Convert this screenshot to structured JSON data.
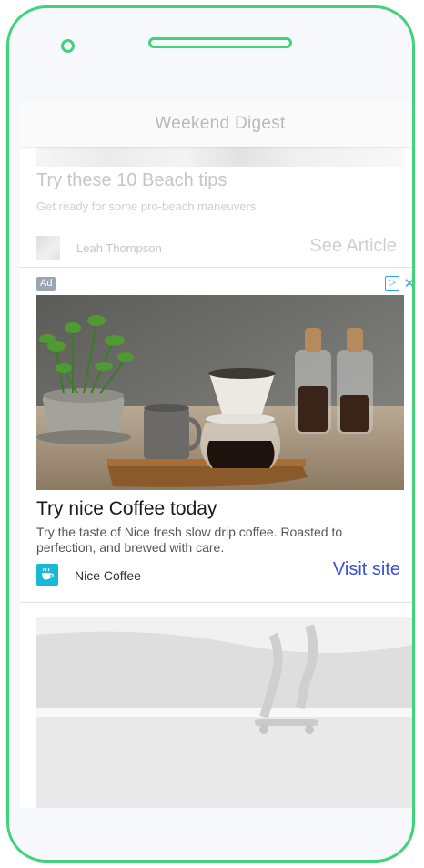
{
  "app": {
    "title": "Weekend Digest"
  },
  "article": {
    "title": "Try these 10 Beach tips",
    "subtitle": "Get ready for some pro-beach maneuvers",
    "author": "Leah Thompson",
    "cta_label": "See Article"
  },
  "ad": {
    "badge": "Ad",
    "title": "Try nice Coffee today",
    "description": "Try the taste of Nice fresh slow drip coffee. Roasted to perfection, and brewed with care.",
    "brand_name": "Nice Coffee",
    "cta_label": "Visit site",
    "cta_color": "#3a4fe0",
    "adchoices_icon": "adchoices-icon",
    "close_icon": "close-icon"
  },
  "colors": {
    "frame": "#3fd37a",
    "brand_logo": "#19b8d6",
    "ad_badge": "#9aa5b1"
  }
}
